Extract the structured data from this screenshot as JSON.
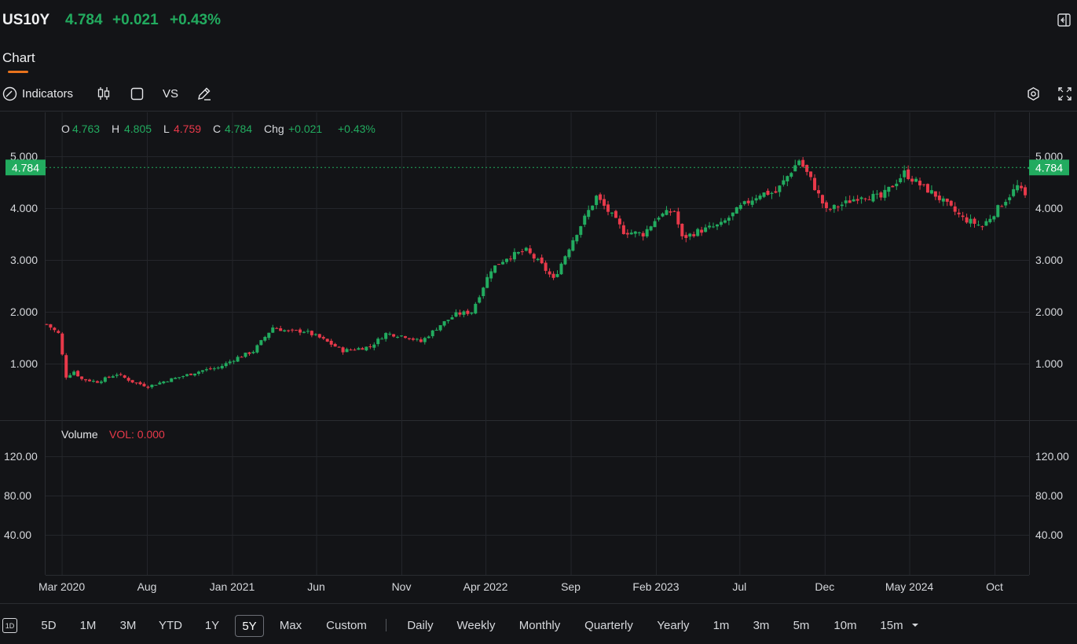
{
  "header": {
    "symbol": "US10Y",
    "price": "4.784",
    "change": "+0.021",
    "change_pct": "+0.43%",
    "up_color": "#22ab5f",
    "down_color": "#e8394a"
  },
  "tabs": [
    {
      "label": "Chart",
      "active": true
    }
  ],
  "toolbar": {
    "indicators_label": "Indicators",
    "vs_label": "VS",
    "icons": [
      "indicators-icon",
      "candlestick-icon",
      "square-icon",
      "vs",
      "draw-icon",
      "settings-icon",
      "fullscreen-icon"
    ]
  },
  "ohlc": {
    "o_label": "O",
    "o_value": "4.763",
    "h_label": "H",
    "h_value": "4.805",
    "l_label": "L",
    "l_value": "4.759",
    "c_label": "C",
    "c_value": "4.784",
    "chg_label": "Chg",
    "chg_value": "+0.021",
    "chg_pct": "+0.43%"
  },
  "volume_legend": {
    "label": "Volume",
    "value": "VOL: 0.000"
  },
  "footer": {
    "ranges": [
      "5D",
      "1M",
      "3M",
      "YTD",
      "1Y",
      "5Y",
      "Max",
      "Custom"
    ],
    "active_range": "5Y",
    "intervals": [
      "Daily",
      "Weekly",
      "Monthly",
      "Quarterly",
      "Yearly",
      "1m",
      "3m",
      "5m",
      "10m",
      "15m"
    ],
    "badge": "1D"
  },
  "chart_data": [
    {
      "type": "candlestick",
      "title": "",
      "x_tick_labels": [
        "Mar 2020",
        "Aug",
        "Jan 2021",
        "Jun",
        "Nov",
        "Apr 2022",
        "Sep",
        "Feb 2023",
        "Jul",
        "Dec",
        "May 2024",
        "Oct"
      ],
      "x_tick_dates": [
        "2020-03-01",
        "2020-08-01",
        "2021-01-01",
        "2021-06-01",
        "2021-11-01",
        "2022-04-01",
        "2022-09-01",
        "2023-02-01",
        "2023-07-01",
        "2023-12-01",
        "2024-05-01",
        "2024-10-01"
      ],
      "x_range": [
        "2020-02-01",
        "2024-12-02"
      ],
      "y_ticks": [
        1,
        2,
        3,
        4,
        5
      ],
      "y_tick_labels": [
        "1.000",
        "2.000",
        "3.000",
        "4.000",
        "5.000"
      ],
      "y_range": [
        0,
        5.25
      ],
      "last_price": 4.784,
      "last_price_label": "4.784",
      "grid": true,
      "weekly_close_anchors": [
        [
          "2020-02-03",
          1.76
        ],
        [
          "2020-02-24",
          1.58
        ],
        [
          "2020-03-09",
          0.75
        ],
        [
          "2020-03-23",
          0.85
        ],
        [
          "2020-04-06",
          0.7
        ],
        [
          "2020-05-04",
          0.65
        ],
        [
          "2020-06-08",
          0.8
        ],
        [
          "2020-07-06",
          0.65
        ],
        [
          "2020-08-03",
          0.56
        ],
        [
          "2020-09-07",
          0.68
        ],
        [
          "2020-10-05",
          0.76
        ],
        [
          "2020-11-09",
          0.87
        ],
        [
          "2020-12-07",
          0.92
        ],
        [
          "2021-01-11",
          1.12
        ],
        [
          "2021-02-08",
          1.24
        ],
        [
          "2021-03-15",
          1.7
        ],
        [
          "2021-04-12",
          1.62
        ],
        [
          "2021-05-10",
          1.63
        ],
        [
          "2021-06-07",
          1.5
        ],
        [
          "2021-07-19",
          1.25
        ],
        [
          "2021-08-09",
          1.28
        ],
        [
          "2021-09-06",
          1.33
        ],
        [
          "2021-10-04",
          1.58
        ],
        [
          "2021-11-08",
          1.53
        ],
        [
          "2021-12-06",
          1.42
        ],
        [
          "2022-01-10",
          1.75
        ],
        [
          "2022-02-07",
          1.95
        ],
        [
          "2022-03-07",
          2.0
        ],
        [
          "2022-04-11",
          2.82
        ],
        [
          "2022-05-09",
          3.05
        ],
        [
          "2022-06-13",
          3.18
        ],
        [
          "2022-07-11",
          2.9
        ],
        [
          "2022-08-01",
          2.62
        ],
        [
          "2022-09-05",
          3.4
        ],
        [
          "2022-10-17",
          4.22
        ],
        [
          "2022-11-14",
          3.85
        ],
        [
          "2022-12-05",
          3.55
        ],
        [
          "2023-01-09",
          3.5
        ],
        [
          "2023-02-06",
          3.85
        ],
        [
          "2023-03-06",
          3.95
        ],
        [
          "2023-03-20",
          3.42
        ],
        [
          "2023-04-17",
          3.55
        ],
        [
          "2023-05-29",
          3.68
        ],
        [
          "2023-07-03",
          4.02
        ],
        [
          "2023-08-07",
          4.28
        ],
        [
          "2023-09-04",
          4.3
        ],
        [
          "2023-10-16",
          4.93
        ],
        [
          "2023-11-06",
          4.55
        ],
        [
          "2023-12-04",
          3.95
        ],
        [
          "2024-01-08",
          4.1
        ],
        [
          "2024-02-05",
          4.25
        ],
        [
          "2024-03-11",
          4.2
        ],
        [
          "2024-04-22",
          4.68
        ],
        [
          "2024-05-20",
          4.45
        ],
        [
          "2024-06-17",
          4.25
        ],
        [
          "2024-08-05",
          3.8
        ],
        [
          "2024-09-09",
          3.65
        ],
        [
          "2024-10-14",
          4.08
        ],
        [
          "2024-11-11",
          4.42
        ],
        [
          "2024-11-25",
          4.22
        ],
        [
          "2024-12-02",
          4.784
        ]
      ]
    },
    {
      "type": "bar",
      "title": "",
      "y_ticks": [
        40,
        80,
        120
      ],
      "y_tick_labels": [
        "40.00",
        "80.00",
        "120.00"
      ],
      "values": []
    }
  ]
}
